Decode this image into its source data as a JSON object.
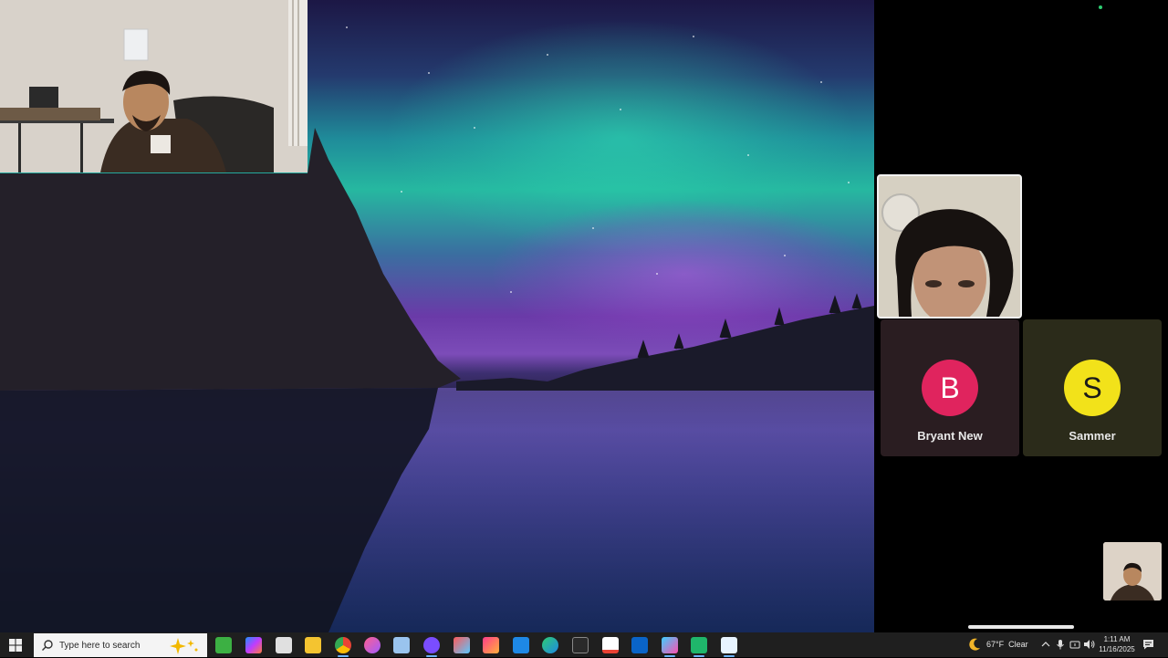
{
  "participants": [
    {
      "name": "Bryant New",
      "initial": "B",
      "color": "#e0245e",
      "text_color": "#ffffff"
    },
    {
      "name": "Sammer",
      "initial": "S",
      "color": "#f2e21a",
      "text_color": "#1a1a1a"
    }
  ],
  "taskbar": {
    "search_placeholder": "Type here to search",
    "apps": [
      "chess-app-icon",
      "copilot-icon",
      "jolly-app-icon",
      "file-explorer-icon",
      "chrome-icon",
      "itunes-icon",
      "laptop-app-icon",
      "chatgpt-icon",
      "color-app-icon",
      "photos-app-icon",
      "todo-icon",
      "edge-icon",
      "epic-games-icon",
      "gmail-icon",
      "outlook-icon",
      "game-app-icon",
      "meet-app-icon",
      "vpn-app-icon"
    ]
  },
  "tray": {
    "weather": "67°F  Clear",
    "time": "1:11 AM",
    "date": "11/16/2025"
  },
  "colors": {
    "taskbar": "#1f1f1f",
    "accent": "#6cb4ff"
  }
}
